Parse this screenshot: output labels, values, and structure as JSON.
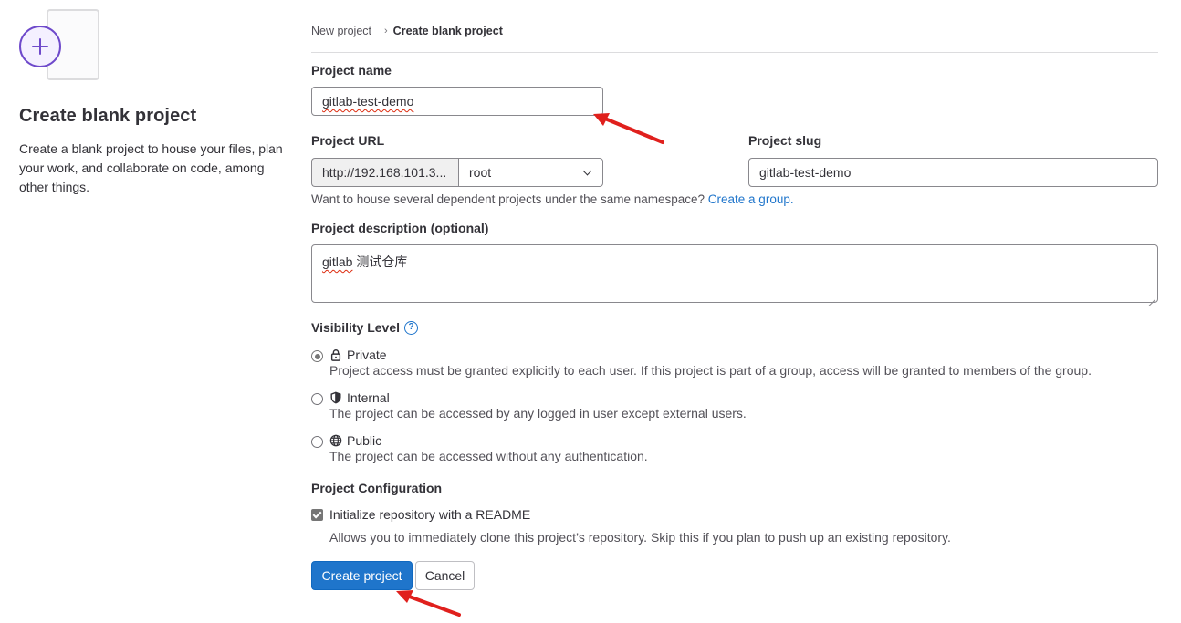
{
  "sidebar": {
    "title": "Create blank project",
    "description": "Create a blank project to house your files, plan your work, and collaborate on code, among other things."
  },
  "breadcrumb": {
    "parent": "New project",
    "current": "Create blank project"
  },
  "form": {
    "project_name_label": "Project name",
    "project_name_value": "gitlab-test-demo",
    "project_url_label": "Project URL",
    "project_url_prefix": "http://192.168.101.3...",
    "namespace_value": "root",
    "project_slug_label": "Project slug",
    "project_slug_value": "gitlab-test-demo",
    "group_hint_text": "Want to house several dependent projects under the same namespace? ",
    "group_hint_link": "Create a group.",
    "description_label": "Project description (optional)",
    "description_value_word": "gitlab",
    "description_value_rest": " 测试仓库",
    "visibility_label": "Visibility Level",
    "visibility_help": "?",
    "visibility_options": [
      {
        "title": "Private",
        "desc": "Project access must be granted explicitly to each user. If this project is part of a group, access will be granted to members of the group.",
        "icon": "lock-icon",
        "checked": true
      },
      {
        "title": "Internal",
        "desc": "The project can be accessed by any logged in user except external users.",
        "icon": "shield-icon",
        "checked": false
      },
      {
        "title": "Public",
        "desc": "The project can be accessed without any authentication.",
        "icon": "globe-icon",
        "checked": false
      }
    ],
    "config_label": "Project Configuration",
    "readme_label": "Initialize repository with a README",
    "readme_checked": true,
    "readme_help": "Allows you to immediately clone this project’s repository. Skip this if you plan to push up an existing repository.",
    "create_button": "Create project",
    "cancel_button": "Cancel"
  },
  "colors": {
    "primary": "#1f75cb",
    "accent_purple": "#6e49cb",
    "annotation_red": "#e0201d"
  }
}
